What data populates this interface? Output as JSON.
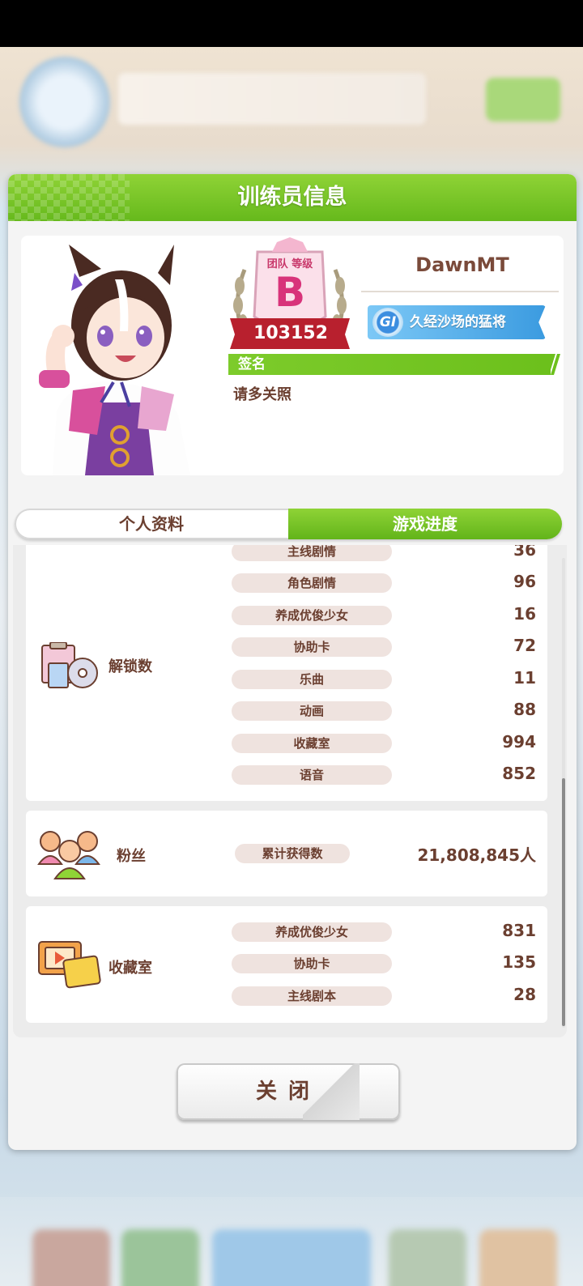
{
  "modal": {
    "title": "训练员信息"
  },
  "trainer": {
    "name": "DawnMT",
    "team_rank_label": "团队 等级",
    "team_rank": "B",
    "team_score": "103152",
    "title_badge": "GI",
    "title": "久经沙场的猛将",
    "sign_label": "签名",
    "sign_text": "请多关照"
  },
  "tabs": [
    {
      "label": "个人资料",
      "active": false
    },
    {
      "label": "游戏进度",
      "active": true
    }
  ],
  "unlocks": {
    "label": "解锁数",
    "rows": [
      {
        "name": "主线剧情",
        "value": "36"
      },
      {
        "name": "角色剧情",
        "value": "96"
      },
      {
        "name": "养成优俊少女",
        "value": "16"
      },
      {
        "name": "协助卡",
        "value": "72"
      },
      {
        "name": "乐曲",
        "value": "11"
      },
      {
        "name": "动画",
        "value": "88"
      },
      {
        "name": "收藏室",
        "value": "994"
      },
      {
        "name": "语音",
        "value": "852"
      }
    ]
  },
  "fans": {
    "label": "粉丝",
    "row": {
      "name": "累计获得数",
      "value": "21,808,845人"
    }
  },
  "collection": {
    "label": "收藏室",
    "rows": [
      {
        "name": "养成优俊少女",
        "value": "831"
      },
      {
        "name": "协助卡",
        "value": "135"
      },
      {
        "name": "主线剧本",
        "value": "28"
      }
    ]
  },
  "buttons": {
    "close": "关闭"
  },
  "colors": {
    "accent_green": "#6cc01c",
    "text_brown": "#6b3f30",
    "title_blue": "#3b9be0"
  }
}
